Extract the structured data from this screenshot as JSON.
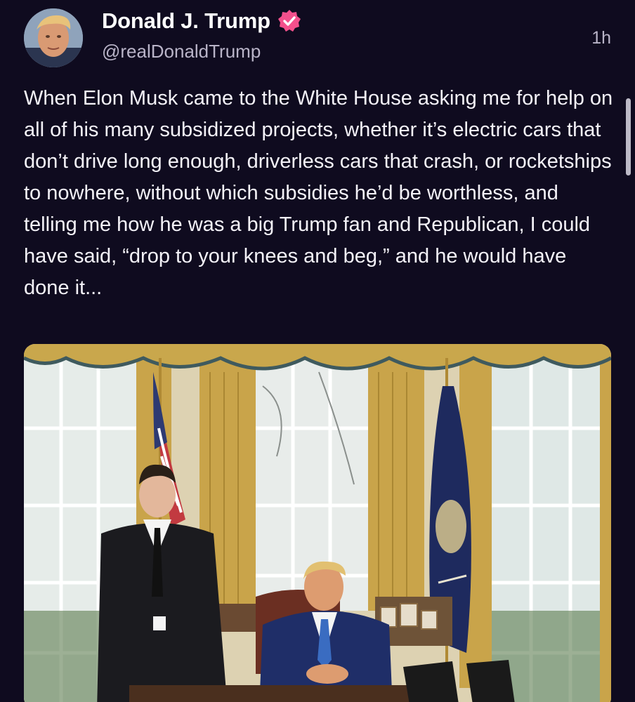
{
  "author": {
    "display_name": "Donald J. Trump",
    "handle": "@realDonaldTrump",
    "verified": true,
    "verified_color": "#f4508c"
  },
  "timestamp": "1h",
  "post": {
    "text": "When Elon Musk came to the White House asking me for help on all of his many subsidized projects, whether it’s electric cars that don’t drive long enough, driverless cars that crash, or rocketships to nowhere, without which subsidies he’d be worthless, and telling me how he was a big Trump fan and Republican, I could have said, “drop to your knees and beg,” and he would have done it..."
  },
  "theme": {
    "background": "#0f0b1f",
    "text": "#f4f2f8",
    "muted": "#b9b4c8"
  },
  "icons": {
    "verified": "verified-badge-icon"
  }
}
